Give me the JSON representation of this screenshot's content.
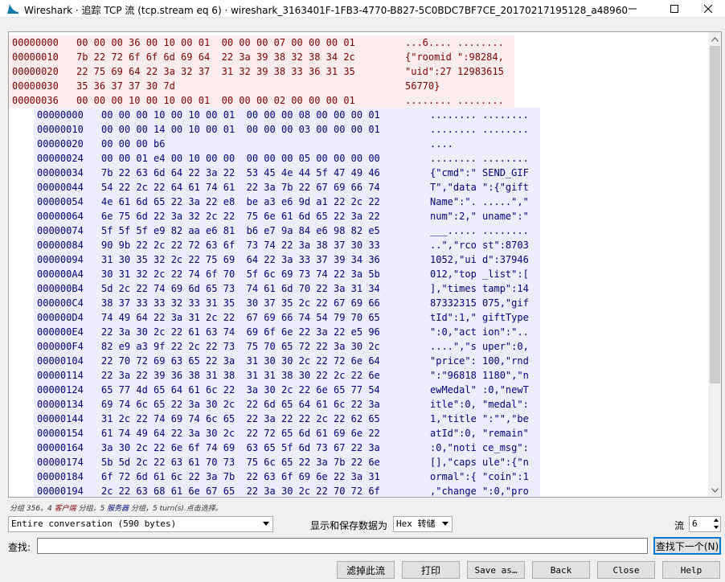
{
  "window": {
    "title": "Wireshark · 追踪 TCP 流 (tcp.stream eq 6) · wireshark_3163401F-1FB3-4770-B827-5C0BDC7BF7CE_20170217195128_a48960",
    "minimize_glyph": "—",
    "maximize_glyph": "☐",
    "close_glyph": "✕"
  },
  "colors": {
    "client_bg": "#fbeded",
    "client_fg": "#800000",
    "server_bg": "#ededfb",
    "server_fg": "#000080"
  },
  "rows": [
    {
      "dir": "client",
      "off": "00000000",
      "hex": "00 00 00 36 00 10 00 01  00 00 00 07 00 00 00 01",
      "ascii": "...6.... ........"
    },
    {
      "dir": "client",
      "off": "00000010",
      "hex": "7b 22 72 6f 6f 6d 69 64  22 3a 39 38 32 38 34 2c",
      "ascii": "{\"roomid \":98284,"
    },
    {
      "dir": "client",
      "off": "00000020",
      "hex": "22 75 69 64 22 3a 32 37  31 32 39 38 33 36 31 35",
      "ascii": "\"uid\":27 12983615"
    },
    {
      "dir": "client",
      "off": "00000030",
      "hex": "35 36 37 37 30 7d",
      "ascii": "56770}"
    },
    {
      "dir": "client",
      "off": "00000036",
      "hex": "00 00 00 10 00 10 00 01  00 00 00 02 00 00 00 01",
      "ascii": "........ ........"
    },
    {
      "dir": "server",
      "off": "00000000",
      "hex": "00 00 00 10 00 10 00 01  00 00 00 08 00 00 00 01",
      "ascii": "........ ........"
    },
    {
      "dir": "server",
      "off": "00000010",
      "hex": "00 00 00 14 00 10 00 01  00 00 00 03 00 00 00 01",
      "ascii": "........ ........"
    },
    {
      "dir": "server",
      "off": "00000020",
      "hex": "00 00 00 b6",
      "ascii": "...."
    },
    {
      "dir": "server",
      "off": "00000024",
      "hex": "00 00 01 e4 00 10 00 00  00 00 00 05 00 00 00 00",
      "ascii": "........ ........"
    },
    {
      "dir": "server",
      "off": "00000034",
      "hex": "7b 22 63 6d 64 22 3a 22  53 45 4e 44 5f 47 49 46",
      "ascii": "{\"cmd\":\" SEND_GIF"
    },
    {
      "dir": "server",
      "off": "00000044",
      "hex": "54 22 2c 22 64 61 74 61  22 3a 7b 22 67 69 66 74",
      "ascii": "T\",\"data \":{\"gift"
    },
    {
      "dir": "server",
      "off": "00000054",
      "hex": "4e 61 6d 65 22 3a 22 e8  be a3 e6 9d a1 22 2c 22",
      "ascii": "Name\":\". .....\",\""
    },
    {
      "dir": "server",
      "off": "00000064",
      "hex": "6e 75 6d 22 3a 32 2c 22  75 6e 61 6d 65 22 3a 22",
      "ascii": "num\":2,\" uname\":\""
    },
    {
      "dir": "server",
      "off": "00000074",
      "hex": "5f 5f 5f e9 82 aa e6 81  b6 e7 9a 84 e6 98 82 e5",
      "ascii": "___..... ........"
    },
    {
      "dir": "server",
      "off": "00000084",
      "hex": "90 9b 22 2c 22 72 63 6f  73 74 22 3a 38 37 30 33",
      "ascii": "..\",\"rco st\":8703"
    },
    {
      "dir": "server",
      "off": "00000094",
      "hex": "31 30 35 32 2c 22 75 69  64 22 3a 33 37 39 34 36",
      "ascii": "1052,\"ui d\":37946"
    },
    {
      "dir": "server",
      "off": "000000A4",
      "hex": "30 31 32 2c 22 74 6f 70  5f 6c 69 73 74 22 3a 5b",
      "ascii": "012,\"top _list\":["
    },
    {
      "dir": "server",
      "off": "000000B4",
      "hex": "5d 2c 22 74 69 6d 65 73  74 61 6d 70 22 3a 31 34",
      "ascii": "],\"times tamp\":14"
    },
    {
      "dir": "server",
      "off": "000000C4",
      "hex": "38 37 33 33 32 33 31 35  30 37 35 2c 22 67 69 66",
      "ascii": "87332315 075,\"gif"
    },
    {
      "dir": "server",
      "off": "000000D4",
      "hex": "74 49 64 22 3a 31 2c 22  67 69 66 74 54 79 70 65",
      "ascii": "tId\":1,\" giftType"
    },
    {
      "dir": "server",
      "off": "000000E4",
      "hex": "22 3a 30 2c 22 61 63 74  69 6f 6e 22 3a 22 e5 96",
      "ascii": "\":0,\"act ion\":\".."
    },
    {
      "dir": "server",
      "off": "000000F4",
      "hex": "82 e9 a3 9f 22 2c 22 73  75 70 65 72 22 3a 30 2c",
      "ascii": "....\",\"s uper\":0,"
    },
    {
      "dir": "server",
      "off": "00000104",
      "hex": "22 70 72 69 63 65 22 3a  31 30 30 2c 22 72 6e 64",
      "ascii": "\"price\": 100,\"rnd"
    },
    {
      "dir": "server",
      "off": "00000114",
      "hex": "22 3a 22 39 36 38 31 38  31 31 38 30 22 2c 22 6e",
      "ascii": "\":\"96818 1180\",\"n"
    },
    {
      "dir": "server",
      "off": "00000124",
      "hex": "65 77 4d 65 64 61 6c 22  3a 30 2c 22 6e 65 77 54",
      "ascii": "ewMedal\" :0,\"newT"
    },
    {
      "dir": "server",
      "off": "00000134",
      "hex": "69 74 6c 65 22 3a 30 2c  22 6d 65 64 61 6c 22 3a",
      "ascii": "itle\":0, \"medal\":"
    },
    {
      "dir": "server",
      "off": "00000144",
      "hex": "31 2c 22 74 69 74 6c 65  22 3a 22 22 2c 22 62 65",
      "ascii": "1,\"title \":\"\",\"be"
    },
    {
      "dir": "server",
      "off": "00000154",
      "hex": "61 74 49 64 22 3a 30 2c  22 72 65 6d 61 69 6e 22",
      "ascii": "atId\":0, \"remain\""
    },
    {
      "dir": "server",
      "off": "00000164",
      "hex": "3a 30 2c 22 6e 6f 74 69  63 65 5f 6d 73 67 22 3a",
      "ascii": ":0,\"noti ce_msg\":"
    },
    {
      "dir": "server",
      "off": "00000174",
      "hex": "5b 5d 2c 22 63 61 70 73  75 6c 65 22 3a 7b 22 6e",
      "ascii": "[],\"caps ule\":{\"n"
    },
    {
      "dir": "server",
      "off": "00000184",
      "hex": "6f 72 6d 61 6c 22 3a 7b  22 63 6f 69 6e 22 3a 31",
      "ascii": "ormal\":{ \"coin\":1"
    },
    {
      "dir": "server",
      "off": "00000194",
      "hex": "2c 22 63 68 61 6e 67 65  22 3a 30 2c 22 70 72 6f",
      "ascii": ",\"change \":0,\"pro"
    }
  ],
  "status": {
    "prefix": "分组 356。4 ",
    "client_label": "客户端",
    "middle": " 分组，5 ",
    "server_label": "服务器",
    "suffix": " 分组，5 turn(s).点击选择。"
  },
  "controls": {
    "conversation_select": "Entire conversation (590 bytes)",
    "format_label": "显示和保存数据为",
    "format_select": "Hex 转储",
    "stream_label": "流",
    "stream_value": "6",
    "find_label": "查找:",
    "find_value": "",
    "find_next": "查找下一个(N)"
  },
  "buttons": {
    "filter_out": "滤掉此流",
    "print": "打印",
    "save_as": "Save as…",
    "back": "Back",
    "close": "Close",
    "help": "Help"
  }
}
